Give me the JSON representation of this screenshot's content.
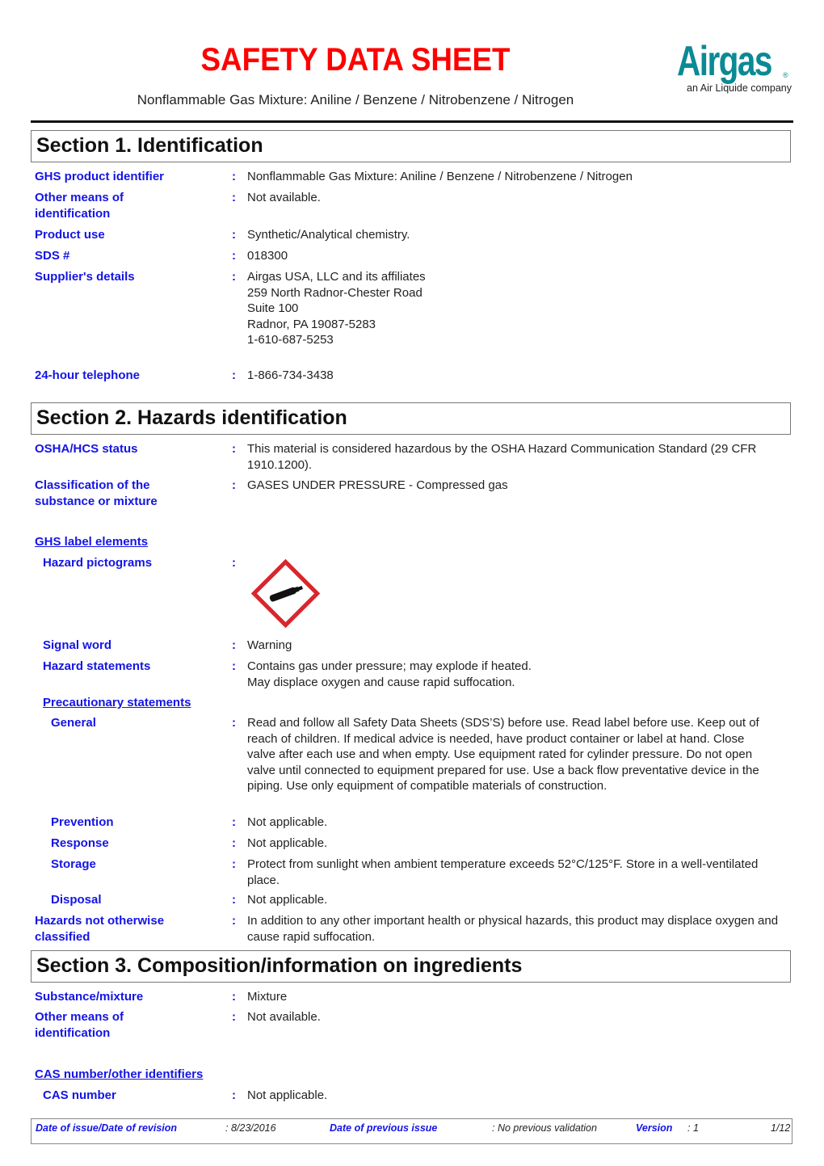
{
  "header": {
    "title": "SAFETY DATA SHEET",
    "subtitle": "Nonflammable Gas Mixture:  Aniline / Benzene / Nitrobenzene / Nitrogen",
    "logo": {
      "name": "Airgas",
      "registered": "®",
      "tagline": "an Air Liquide company",
      "color": "#0a8a94"
    },
    "title_color": "#ff0000"
  },
  "section1": {
    "title": "Section 1. Identification",
    "rows": [
      {
        "label": "GHS product identifier",
        "value": "Nonflammable Gas Mixture:  Aniline / Benzene / Nitrobenzene / Nitrogen"
      },
      {
        "label": "Other means of identification",
        "value": "Not available."
      },
      {
        "label": "Product use",
        "value": "Synthetic/Analytical chemistry."
      },
      {
        "label": "SDS #",
        "value": "018300"
      },
      {
        "label": "Supplier's details",
        "value_lines": [
          "Airgas USA, LLC and its affiliates",
          "259 North Radnor-Chester Road",
          "Suite 100",
          "Radnor, PA 19087-5283",
          "1-610-687-5253"
        ]
      },
      {
        "label": "24-hour telephone",
        "value": "1-866-734-3438"
      }
    ]
  },
  "section2": {
    "title": "Section 2. Hazards identification",
    "osha_label": "OSHA/HCS status",
    "osha_value": "This material is considered hazardous by the OSHA Hazard Communication Standard (29 CFR 1910.1200).",
    "classification_label": "Classification of the substance or mixture",
    "classification_value": "GASES UNDER PRESSURE - Compressed gas",
    "ghs_label_elements": "GHS label elements",
    "pictograms_label": "Hazard pictograms",
    "pictogram_icon": "gas-cylinder-icon",
    "pictogram_color": "#d9262c",
    "signal_word_label": "Signal word",
    "signal_word": "Warning",
    "hazard_statements_label": "Hazard statements",
    "hazard_statements": [
      "Contains gas under pressure; may explode if heated.",
      "May displace oxygen and cause rapid suffocation."
    ],
    "precautionary_label": "Precautionary statements",
    "general_label": "General",
    "general_value": "Read and follow all Safety Data Sheets (SDS’S) before use.  Read label before use.  Keep out of reach of children.  If medical advice is needed, have product container or label at hand.  Close valve after each use and when empty.  Use equipment rated for cylinder pressure.  Do not open valve until connected to equipment prepared for use.  Use a back flow preventative device in the piping.  Use only equipment of compatible materials of construction.",
    "prevention_label": "Prevention",
    "prevention_value": "Not applicable.",
    "response_label": "Response",
    "response_value": "Not applicable.",
    "storage_label": "Storage",
    "storage_value": "Protect from sunlight when ambient temperature exceeds 52°C/125°F.  Store in a well-ventilated place.",
    "disposal_label": "Disposal",
    "disposal_value": "Not applicable.",
    "hnoc_label": "Hazards not otherwise classified",
    "hnoc_value": "In addition to any other important health or physical hazards, this product may displace oxygen and cause rapid suffocation."
  },
  "section3": {
    "title": "Section 3. Composition/information on ingredients",
    "substance_label": "Substance/mixture",
    "substance_value": "Mixture",
    "other_label": "Other means of identification",
    "other_value": "Not available.",
    "cas_header": "CAS number/other identifiers",
    "cas_label": "CAS number",
    "cas_value": "Not applicable."
  },
  "footer": {
    "issue_label": "Date of issue/Date of revision",
    "issue_value": ": 8/23/2016",
    "prev_label": "Date of previous issue",
    "prev_value": ": No previous validation",
    "version_label": "Version",
    "version_value": ": 1",
    "page": "1/12"
  },
  "colon": ":"
}
